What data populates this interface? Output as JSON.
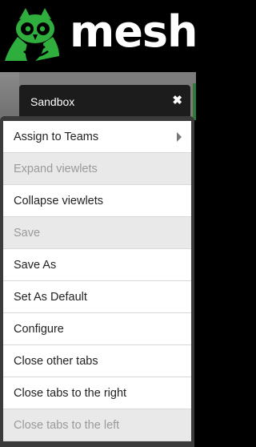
{
  "header": {
    "logo_text": "mesh",
    "brand_color": "#2fae3e"
  },
  "tab": {
    "title": "Sandbox",
    "close_glyph": "✖"
  },
  "context_menu": {
    "items": [
      {
        "label": "Assign to Teams",
        "disabled": false,
        "has_submenu": true
      },
      {
        "label": "Expand viewlets",
        "disabled": true
      },
      {
        "label": "Collapse viewlets",
        "disabled": false
      },
      {
        "label": "Save",
        "disabled": true
      },
      {
        "label": "Save As",
        "disabled": false
      },
      {
        "label": "Set As Default",
        "disabled": false
      },
      {
        "label": "Configure",
        "disabled": false
      },
      {
        "label": "Close other tabs",
        "disabled": false
      },
      {
        "label": "Close tabs to the right",
        "disabled": false
      },
      {
        "label": "Close tabs to the left",
        "disabled": true
      }
    ]
  }
}
